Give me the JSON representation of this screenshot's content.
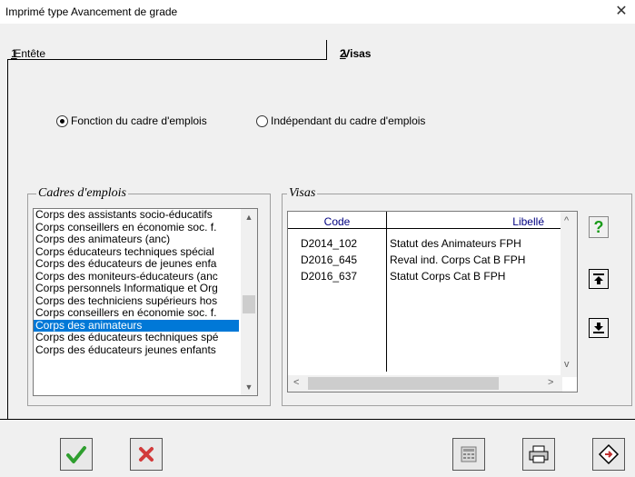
{
  "window": {
    "title": "Imprimé type Avancement de grade",
    "close_glyph": "✕"
  },
  "tabs": [
    {
      "accel": "1",
      "label": ".Entête"
    },
    {
      "accel": "2",
      "label": ".Visas"
    }
  ],
  "options": {
    "fonction": "Fonction du cadre d'emplois",
    "independant": "Indépendant du cadre d'emplois",
    "selected": "fonction"
  },
  "cadres": {
    "label": "Cadres d'emplois",
    "items": [
      "Corps des assistants socio-éducatifs",
      "Corps conseillers en économie soc. f.",
      "Corps des animateurs (anc)",
      "Corps éducateurs techniques spécial",
      "Corps des éducateurs de jeunes enfa",
      "Corps des moniteurs-éducateurs (anc",
      "Corps personnels Informatique et Org",
      "Corps des techniciens supérieurs hos",
      "Corps conseillers en économie soc. f.",
      "Corps des animateurs",
      "Corps des éducateurs techniques spé",
      "Corps des éducateurs jeunes enfants"
    ],
    "selected_index": 9
  },
  "visas": {
    "label": "Visas",
    "columns": {
      "code": "Code",
      "libelle": "Libellé"
    },
    "rows": [
      {
        "code": "D2014_102",
        "libelle": "Statut des Animateurs FPH"
      },
      {
        "code": "D2016_645",
        "libelle": "Reval ind. Corps Cat B FPH"
      },
      {
        "code": "D2016_637",
        "libelle": "Statut Corps Cat B FPH"
      }
    ]
  },
  "icons": {
    "help": "?",
    "move_up": "up-arrow-icon",
    "move_down": "down-arrow-icon",
    "ok": "checkmark-icon",
    "cancel": "x-icon",
    "calc": "calculator-icon",
    "print": "printer-icon",
    "exit": "exit-icon"
  }
}
